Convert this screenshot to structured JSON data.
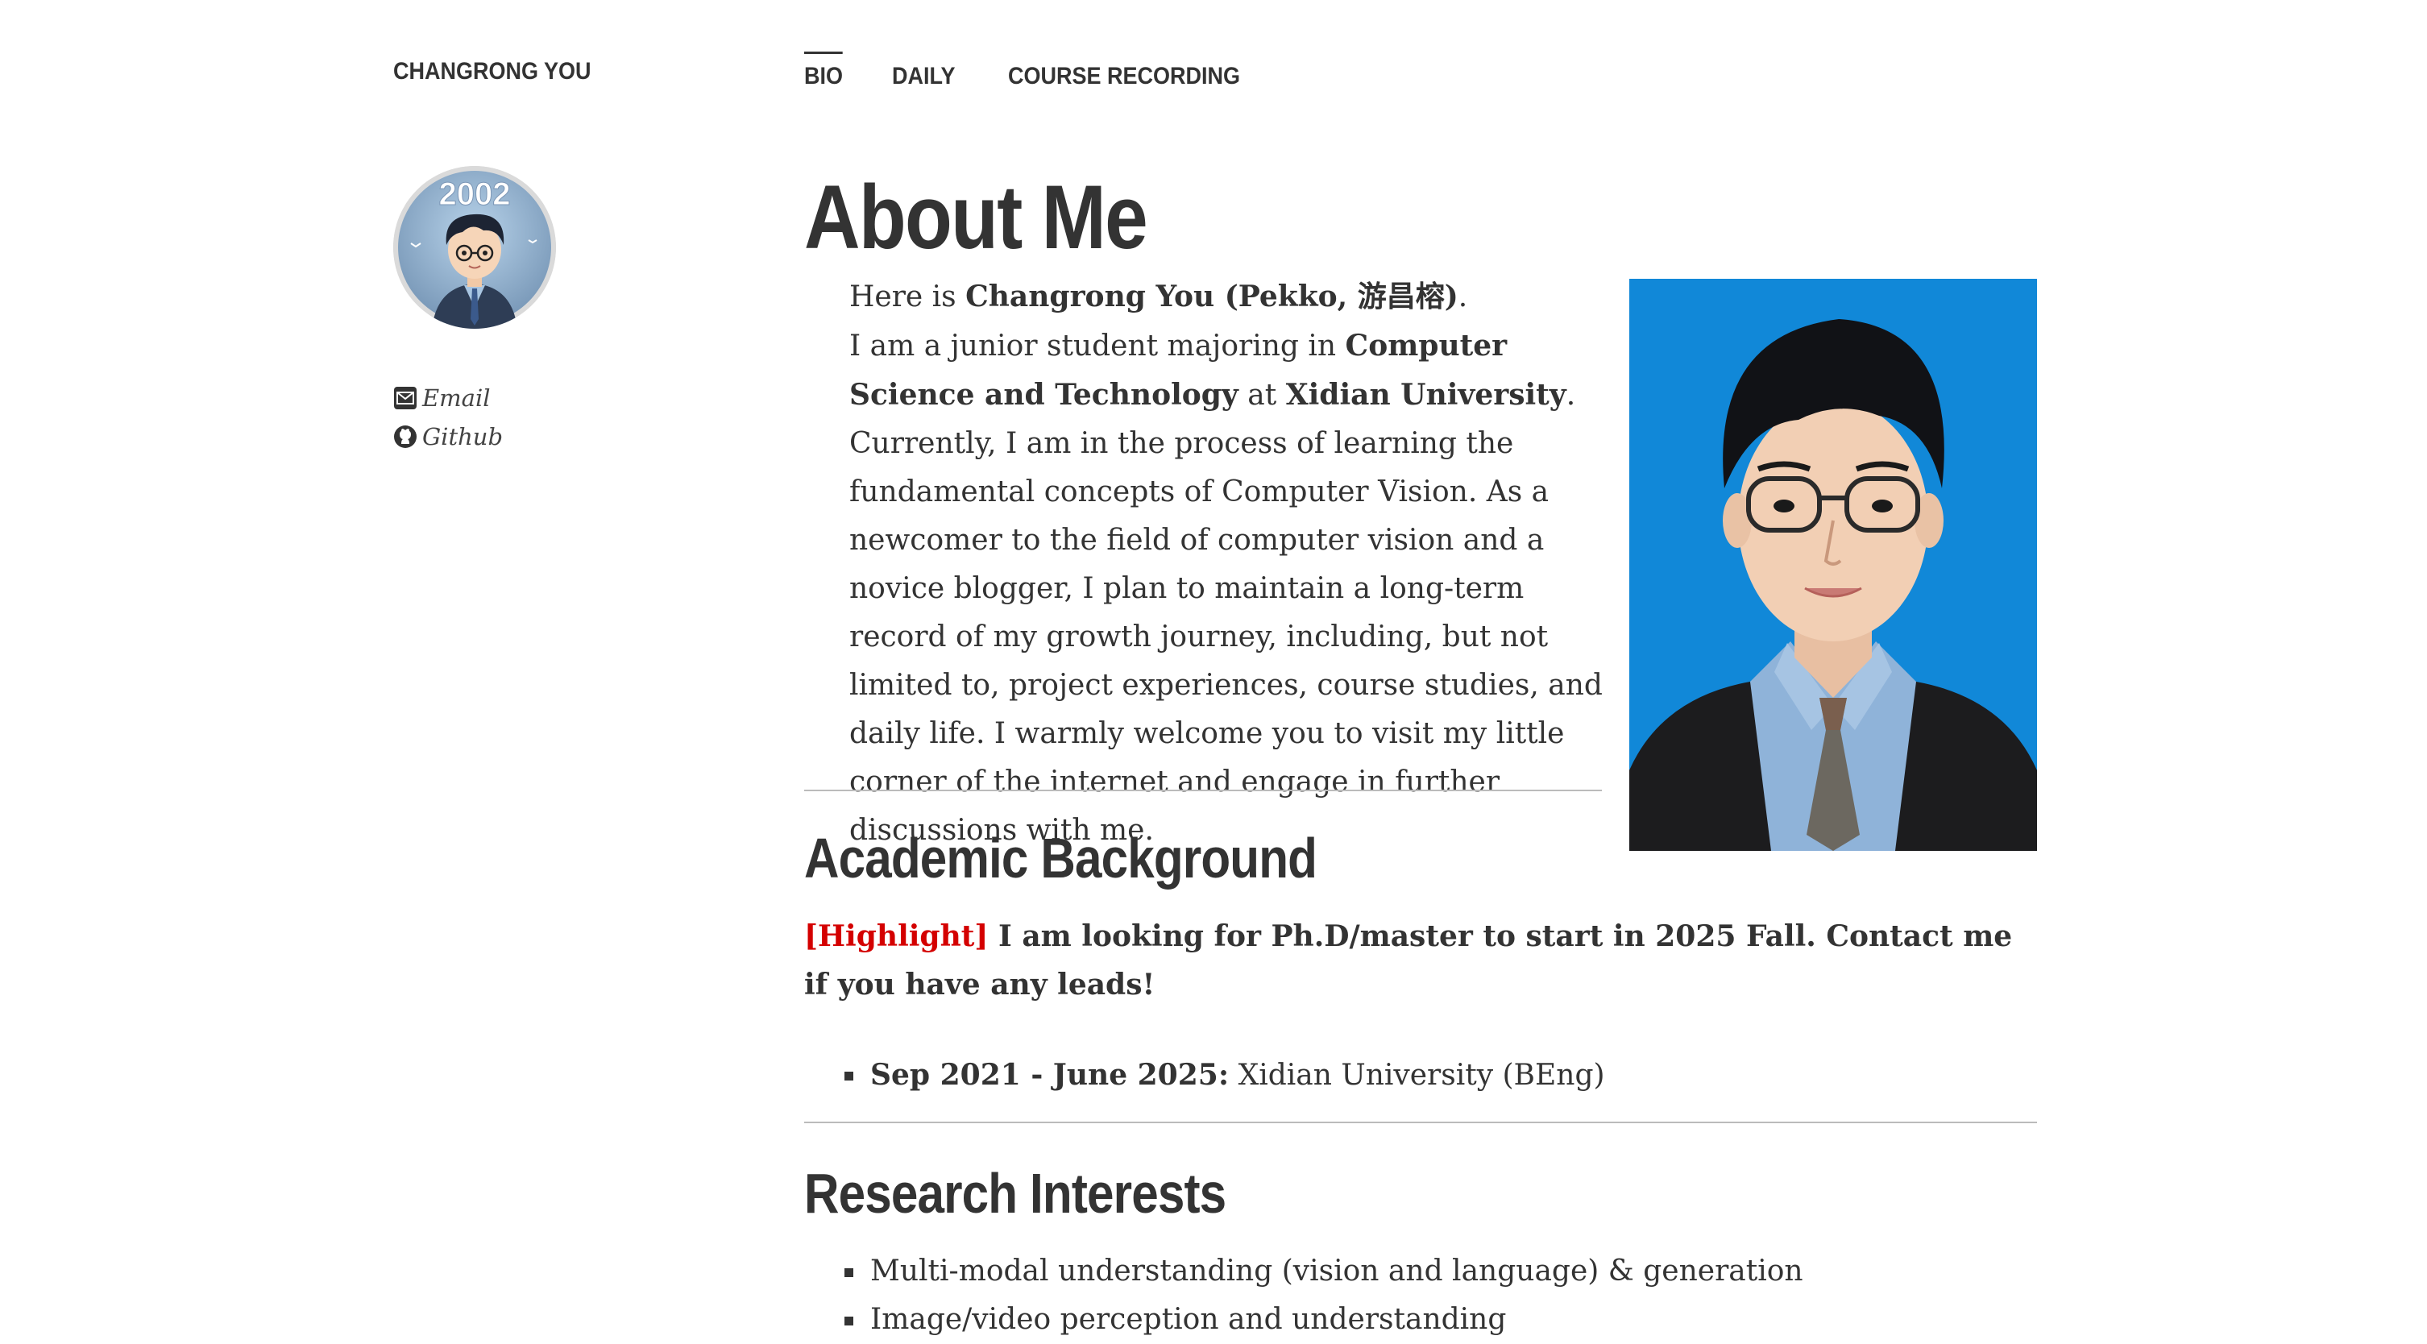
{
  "site": {
    "title": "CHANGRONG YOU",
    "avatar_text": "2002"
  },
  "nav": {
    "items": [
      {
        "label": "BIO",
        "active": true
      },
      {
        "label": "DAILY",
        "active": false
      },
      {
        "label": "COURSE RECORDING",
        "active": false
      }
    ]
  },
  "sidebar": {
    "contacts": [
      {
        "label": "Email",
        "icon": "envelope-icon"
      },
      {
        "label": "Github",
        "icon": "github-icon"
      }
    ]
  },
  "main": {
    "title": "About Me",
    "intro": {
      "p1_prefix": "Here is ",
      "p1_name": "Changrong You (Pekko, 游昌榕)",
      "p1_suffix": ".",
      "p2_prefix": "I am a junior student majoring in ",
      "p2_major": "Computer Science and Technology",
      "p2_mid": " at ",
      "p2_school": "Xidian University",
      "p2_rest": ". Currently, I am in the process of learning the fundamental concepts of Computer Vision. As a newcomer to the field of computer vision and a novice blogger, I plan to maintain a long-term record of my growth journey, including, but not limited to, project experiences, course studies, and daily life. I warmly welcome you to visit my little corner of the internet and engage in further discussions with me."
    },
    "academic": {
      "heading": "Academic Background",
      "highlight_tag": "[Highlight]",
      "highlight_text": " I am looking for Ph.D/master to start in 2025 Fall. Contact me if you have any leads!",
      "education": [
        {
          "period": "Sep 2021 - June 2025:",
          "detail": " Xidian University (BEng)"
        }
      ]
    },
    "research": {
      "heading": "Research Interests",
      "items": [
        "Multi-modal understanding (vision and language) & generation",
        "Image/video perception and understanding"
      ]
    }
  },
  "colors": {
    "text": "#333333",
    "highlight": "#d40000",
    "photo_background": "#1188d8",
    "rule": "#bbbbbb"
  }
}
